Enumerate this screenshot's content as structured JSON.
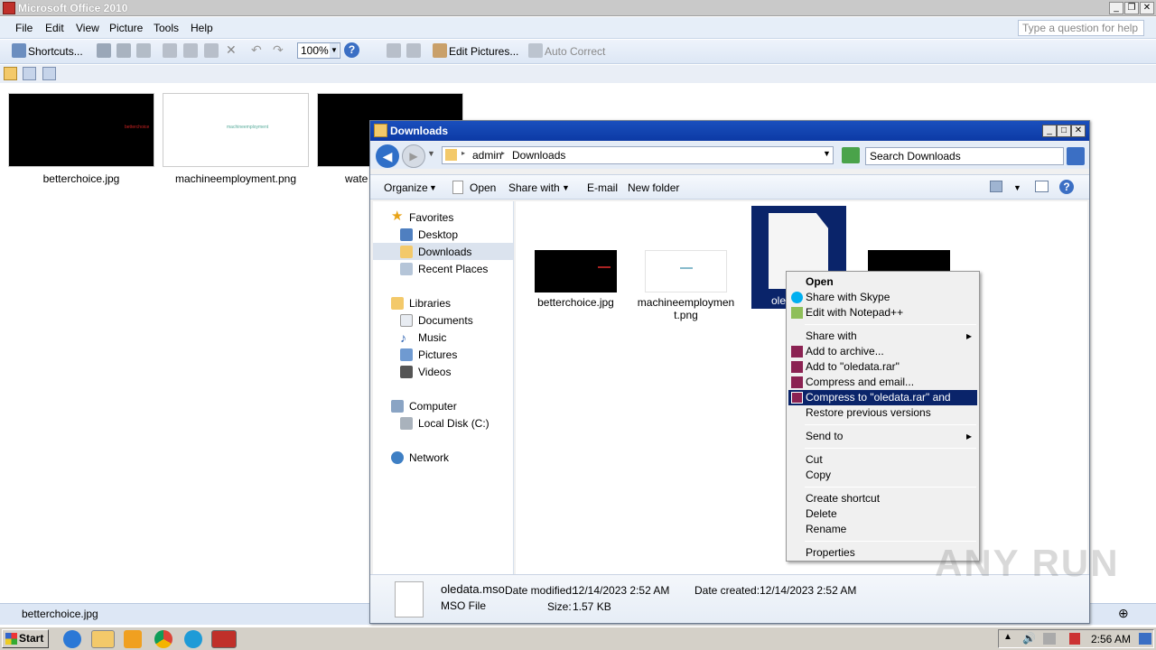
{
  "office": {
    "title": "Microsoft Office 2010",
    "menu": [
      "File",
      "Edit",
      "View",
      "Picture",
      "Tools",
      "Help"
    ],
    "ask_placeholder": "Type a question for help",
    "toolbar": {
      "shortcuts": "Shortcuts...",
      "zoom": "100%",
      "edit_pictures": "Edit Pictures...",
      "auto_correct": "Auto Correct"
    },
    "thumbnails": [
      {
        "name": "betterchoice.jpg",
        "inner_text": "betterchoice"
      },
      {
        "name": "machineemployment.png",
        "inner_text": "machineemployment"
      },
      {
        "name": "wate"
      }
    ],
    "status_filename": "betterchoice.jpg"
  },
  "explorer": {
    "title": "Downloads",
    "breadcrumb": [
      "admin",
      "Downloads"
    ],
    "search_placeholder": "Search Downloads",
    "commands": {
      "organize": "Organize",
      "open": "Open",
      "share_with": "Share with",
      "email": "E-mail",
      "new_folder": "New folder"
    },
    "nav": {
      "favorites_label": "Favorites",
      "favorites": [
        "Desktop",
        "Downloads",
        "Recent Places"
      ],
      "libraries_label": "Libraries",
      "libraries": [
        "Documents",
        "Music",
        "Pictures",
        "Videos"
      ],
      "computer_label": "Computer",
      "computer": [
        "Local Disk (C:)"
      ],
      "network_label": "Network"
    },
    "files": [
      {
        "name": "betterchoice.jpg"
      },
      {
        "name_line1": "machineemploymen",
        "name_line2": "t.png"
      },
      {
        "name": "ole"
      }
    ],
    "details": {
      "filename": "oledata.mso",
      "type": "MSO File",
      "date_modified_label": "Date modified:",
      "date_modified": "12/14/2023 2:52 AM",
      "date_created_label": "Date created:",
      "date_created": "12/14/2023 2:52 AM",
      "size_label": "Size:",
      "size": "1.57 KB"
    }
  },
  "context_menu": {
    "items": [
      {
        "label": "Open"
      },
      {
        "label": "Share with Skype"
      },
      {
        "label": "Edit with Notepad++"
      },
      {
        "label": "Share with"
      },
      {
        "label": "Add to archive..."
      },
      {
        "label": "Add to \"oledata.rar\""
      },
      {
        "label": "Compress and email..."
      },
      {
        "label": "Compress to \"oledata.rar\" and email"
      },
      {
        "label": "Restore previous versions"
      },
      {
        "label": "Send to"
      },
      {
        "label": "Cut"
      },
      {
        "label": "Copy"
      },
      {
        "label": "Create shortcut"
      },
      {
        "label": "Delete"
      },
      {
        "label": "Rename"
      },
      {
        "label": "Properties"
      }
    ],
    "highlighted": "Compress to \"oledata.rar\" and email"
  },
  "taskbar": {
    "start": "Start",
    "time": "2:56 AM"
  },
  "watermark": "ANY RUN",
  "colors": {
    "title_blue": "#0c3aa5",
    "highlight": "#0a246a",
    "office_red": "#c0302a"
  }
}
